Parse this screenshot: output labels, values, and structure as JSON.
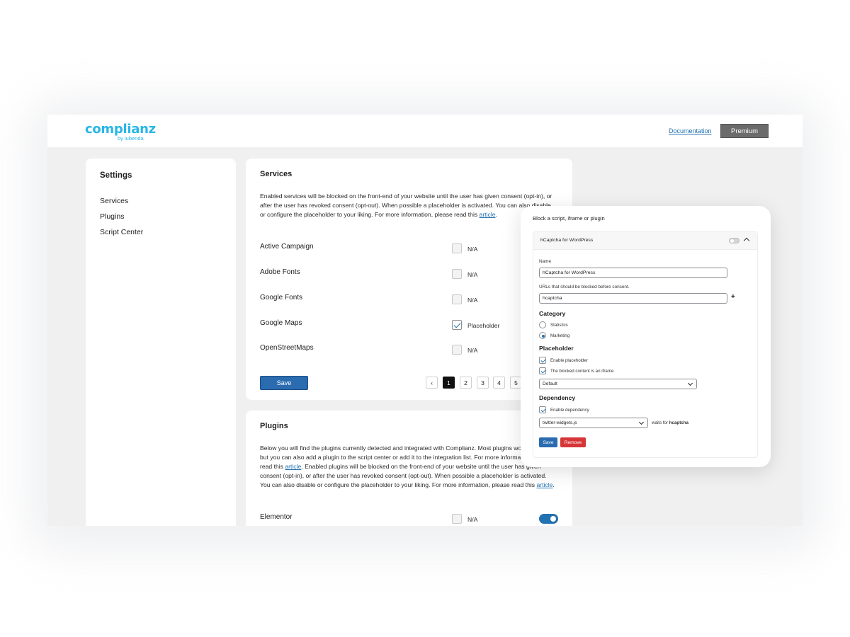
{
  "header": {
    "logo_text": "complianz",
    "logo_sub": "by iubenda",
    "documentation": "Documentation",
    "premium": "Premium"
  },
  "sidebar": {
    "title": "Settings",
    "items": [
      {
        "label": "Services"
      },
      {
        "label": "Plugins"
      },
      {
        "label": "Script Center"
      }
    ]
  },
  "services": {
    "title": "Services",
    "description_pre": "Enabled services will be blocked on the front-end of your website until the user has given consent (opt-in), or after the user has revoked consent (opt-out). When possible a placeholder is activated. You can also disable or configure the placeholder to your liking. For more information, please read this ",
    "description_link": "article",
    "description_post": ".",
    "rows": [
      {
        "name": "Active Campaign",
        "status": "N/A",
        "checked": false
      },
      {
        "name": "Adobe Fonts",
        "status": "N/A",
        "checked": false
      },
      {
        "name": "Google Fonts",
        "status": "N/A",
        "checked": false
      },
      {
        "name": "Google Maps",
        "status": "Placeholder",
        "checked": true
      },
      {
        "name": "OpenStreetMaps",
        "status": "N/A",
        "checked": false
      }
    ],
    "save": "Save",
    "pagination": {
      "prev": "‹",
      "pages": [
        "1",
        "2",
        "3",
        "4",
        "5"
      ],
      "current": "1"
    }
  },
  "plugins": {
    "title": "Plugins",
    "d1": "Below you will find the plugins currently detected and integrated with Complianz. Most plugins work by default, but you can also add a plugin to the script center or add it to the integration list. For more information, please read this ",
    "d_link1": "article",
    "d2": ". Enabled plugins will be blocked on the front-end of your website until the user has given consent (opt-in), or after the user has revoked consent (opt-out). When possible a placeholder is activated. You can also disable or configure the placeholder to your liking. For more information, please read this ",
    "d_link2": "article",
    "d3": ".",
    "rows": [
      {
        "name": "Elementor",
        "status": "N/A",
        "enabled": true
      }
    ]
  },
  "popup": {
    "title": "Block a script, iframe or plugin",
    "panel_title": "hCaptcha for WordPress",
    "name_label": "Name",
    "name_value": "hCaptcha for WordPress",
    "urls_label": "URLs that should be blocked before consent.",
    "urls_value": "hcaptcha",
    "category_heading": "Category",
    "category_options": [
      "Statistics",
      "Marketing"
    ],
    "category_selected": "Marketing",
    "placeholder_heading": "Placeholder",
    "enable_placeholder": "Enable placeholder",
    "iframe_label": "The blocked content is an iframe",
    "placeholder_select": "Default",
    "dependency_heading": "Dependency",
    "enable_dependency": "Enable dependency",
    "dependency_select": "twitter-widgets.js",
    "waits_for_pre": "waits for ",
    "waits_for_target": "hcaptcha",
    "save": "Save",
    "remove": "Remove"
  },
  "colors": {
    "brand": "#29b6e6",
    "primary": "#2b6cb0",
    "danger": "#d63638",
    "premium": "#6b6b6b"
  }
}
